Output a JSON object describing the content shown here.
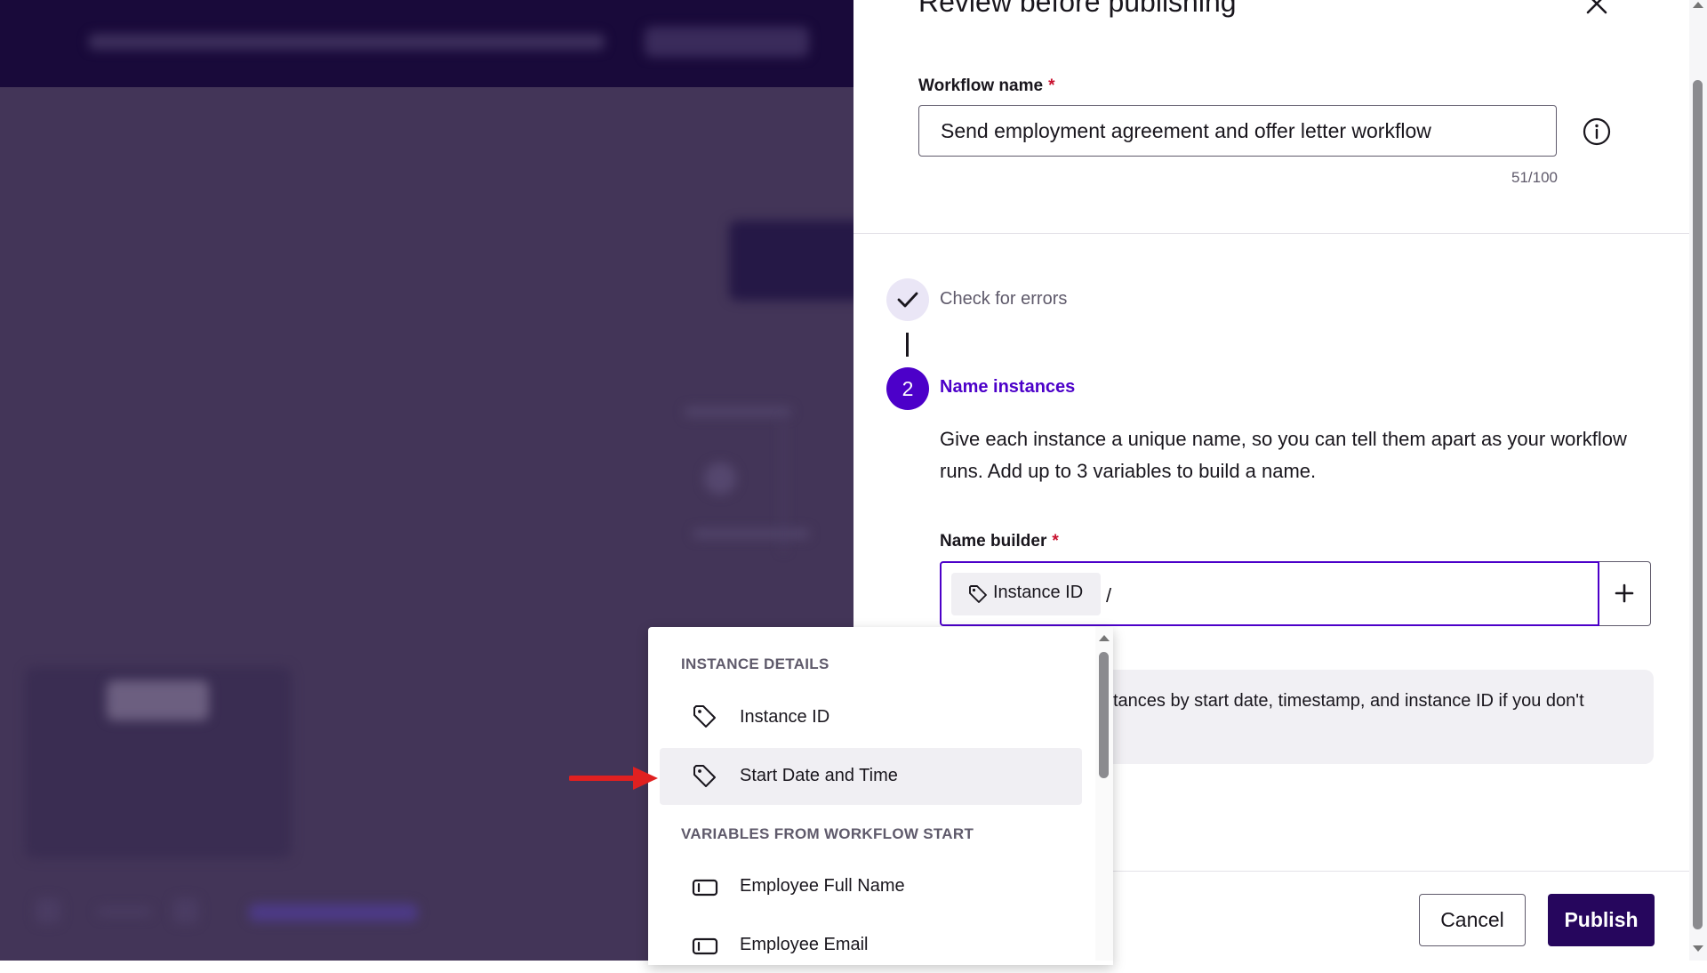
{
  "panel": {
    "title": "Review before publishing",
    "workflow_name_label": "Workflow name",
    "required_marker": "*",
    "workflow_name_value": "Send employment agreement and offer letter workflow",
    "char_count": "51/100"
  },
  "steps": {
    "step1_label": "Check for errors",
    "step2_number": "2",
    "step2_label": "Name instances",
    "step2_description": "Give each instance a unique name, so you can tell them apart as your workflow runs. Add up to 3 variables to build a name."
  },
  "name_builder": {
    "label": "Name builder",
    "chip_label": "Instance ID",
    "separator": "/"
  },
  "hint": {
    "text": "tances by start date, timestamp, and instance ID if you don't"
  },
  "footer": {
    "cancel_label": "Cancel",
    "publish_label": "Publish"
  },
  "dropdown": {
    "section1_heading": "INSTANCE DETAILS",
    "item_instance_id": "Instance ID",
    "item_start_date": "Start Date and Time",
    "section2_heading": "VARIABLES FROM WORKFLOW START",
    "item_employee_name": "Employee Full Name",
    "item_employee_email": "Employee Email"
  },
  "colors": {
    "accent": "#4c00c9",
    "publish_bg": "#26065d",
    "required": "#c8102e",
    "annotation_arrow": "#e02020"
  },
  "icons": [
    "close-icon",
    "info-icon",
    "checkmark-icon",
    "tag-icon",
    "text-field-icon",
    "plus-icon",
    "red-arrow-annotation"
  ]
}
